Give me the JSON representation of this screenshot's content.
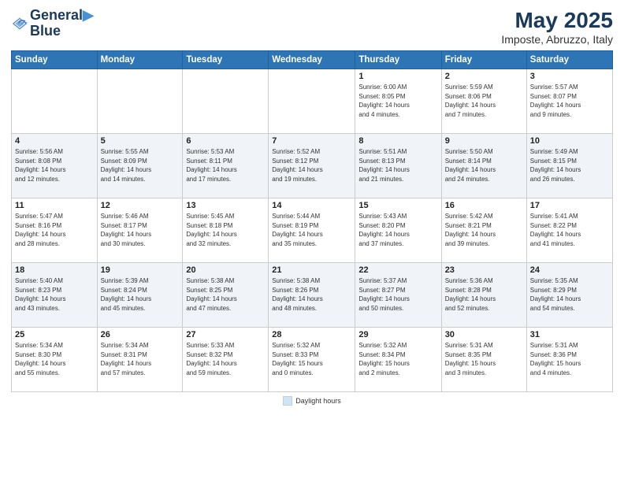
{
  "logo": {
    "line1": "General",
    "line2": "Blue"
  },
  "title": "May 2025",
  "subtitle": "Imposte, Abruzzo, Italy",
  "days_of_week": [
    "Sunday",
    "Monday",
    "Tuesday",
    "Wednesday",
    "Thursday",
    "Friday",
    "Saturday"
  ],
  "weeks": [
    [
      {
        "day": "",
        "info": ""
      },
      {
        "day": "",
        "info": ""
      },
      {
        "day": "",
        "info": ""
      },
      {
        "day": "",
        "info": ""
      },
      {
        "day": "1",
        "info": "Sunrise: 6:00 AM\nSunset: 8:05 PM\nDaylight: 14 hours\nand 4 minutes."
      },
      {
        "day": "2",
        "info": "Sunrise: 5:59 AM\nSunset: 8:06 PM\nDaylight: 14 hours\nand 7 minutes."
      },
      {
        "day": "3",
        "info": "Sunrise: 5:57 AM\nSunset: 8:07 PM\nDaylight: 14 hours\nand 9 minutes."
      }
    ],
    [
      {
        "day": "4",
        "info": "Sunrise: 5:56 AM\nSunset: 8:08 PM\nDaylight: 14 hours\nand 12 minutes."
      },
      {
        "day": "5",
        "info": "Sunrise: 5:55 AM\nSunset: 8:09 PM\nDaylight: 14 hours\nand 14 minutes."
      },
      {
        "day": "6",
        "info": "Sunrise: 5:53 AM\nSunset: 8:11 PM\nDaylight: 14 hours\nand 17 minutes."
      },
      {
        "day": "7",
        "info": "Sunrise: 5:52 AM\nSunset: 8:12 PM\nDaylight: 14 hours\nand 19 minutes."
      },
      {
        "day": "8",
        "info": "Sunrise: 5:51 AM\nSunset: 8:13 PM\nDaylight: 14 hours\nand 21 minutes."
      },
      {
        "day": "9",
        "info": "Sunrise: 5:50 AM\nSunset: 8:14 PM\nDaylight: 14 hours\nand 24 minutes."
      },
      {
        "day": "10",
        "info": "Sunrise: 5:49 AM\nSunset: 8:15 PM\nDaylight: 14 hours\nand 26 minutes."
      }
    ],
    [
      {
        "day": "11",
        "info": "Sunrise: 5:47 AM\nSunset: 8:16 PM\nDaylight: 14 hours\nand 28 minutes."
      },
      {
        "day": "12",
        "info": "Sunrise: 5:46 AM\nSunset: 8:17 PM\nDaylight: 14 hours\nand 30 minutes."
      },
      {
        "day": "13",
        "info": "Sunrise: 5:45 AM\nSunset: 8:18 PM\nDaylight: 14 hours\nand 32 minutes."
      },
      {
        "day": "14",
        "info": "Sunrise: 5:44 AM\nSunset: 8:19 PM\nDaylight: 14 hours\nand 35 minutes."
      },
      {
        "day": "15",
        "info": "Sunrise: 5:43 AM\nSunset: 8:20 PM\nDaylight: 14 hours\nand 37 minutes."
      },
      {
        "day": "16",
        "info": "Sunrise: 5:42 AM\nSunset: 8:21 PM\nDaylight: 14 hours\nand 39 minutes."
      },
      {
        "day": "17",
        "info": "Sunrise: 5:41 AM\nSunset: 8:22 PM\nDaylight: 14 hours\nand 41 minutes."
      }
    ],
    [
      {
        "day": "18",
        "info": "Sunrise: 5:40 AM\nSunset: 8:23 PM\nDaylight: 14 hours\nand 43 minutes."
      },
      {
        "day": "19",
        "info": "Sunrise: 5:39 AM\nSunset: 8:24 PM\nDaylight: 14 hours\nand 45 minutes."
      },
      {
        "day": "20",
        "info": "Sunrise: 5:38 AM\nSunset: 8:25 PM\nDaylight: 14 hours\nand 47 minutes."
      },
      {
        "day": "21",
        "info": "Sunrise: 5:38 AM\nSunset: 8:26 PM\nDaylight: 14 hours\nand 48 minutes."
      },
      {
        "day": "22",
        "info": "Sunrise: 5:37 AM\nSunset: 8:27 PM\nDaylight: 14 hours\nand 50 minutes."
      },
      {
        "day": "23",
        "info": "Sunrise: 5:36 AM\nSunset: 8:28 PM\nDaylight: 14 hours\nand 52 minutes."
      },
      {
        "day": "24",
        "info": "Sunrise: 5:35 AM\nSunset: 8:29 PM\nDaylight: 14 hours\nand 54 minutes."
      }
    ],
    [
      {
        "day": "25",
        "info": "Sunrise: 5:34 AM\nSunset: 8:30 PM\nDaylight: 14 hours\nand 55 minutes."
      },
      {
        "day": "26",
        "info": "Sunrise: 5:34 AM\nSunset: 8:31 PM\nDaylight: 14 hours\nand 57 minutes."
      },
      {
        "day": "27",
        "info": "Sunrise: 5:33 AM\nSunset: 8:32 PM\nDaylight: 14 hours\nand 59 minutes."
      },
      {
        "day": "28",
        "info": "Sunrise: 5:32 AM\nSunset: 8:33 PM\nDaylight: 15 hours\nand 0 minutes."
      },
      {
        "day": "29",
        "info": "Sunrise: 5:32 AM\nSunset: 8:34 PM\nDaylight: 15 hours\nand 2 minutes."
      },
      {
        "day": "30",
        "info": "Sunrise: 5:31 AM\nSunset: 8:35 PM\nDaylight: 15 hours\nand 3 minutes."
      },
      {
        "day": "31",
        "info": "Sunrise: 5:31 AM\nSunset: 8:36 PM\nDaylight: 15 hours\nand 4 minutes."
      }
    ]
  ],
  "legend": {
    "daylight_label": "Daylight hours"
  }
}
